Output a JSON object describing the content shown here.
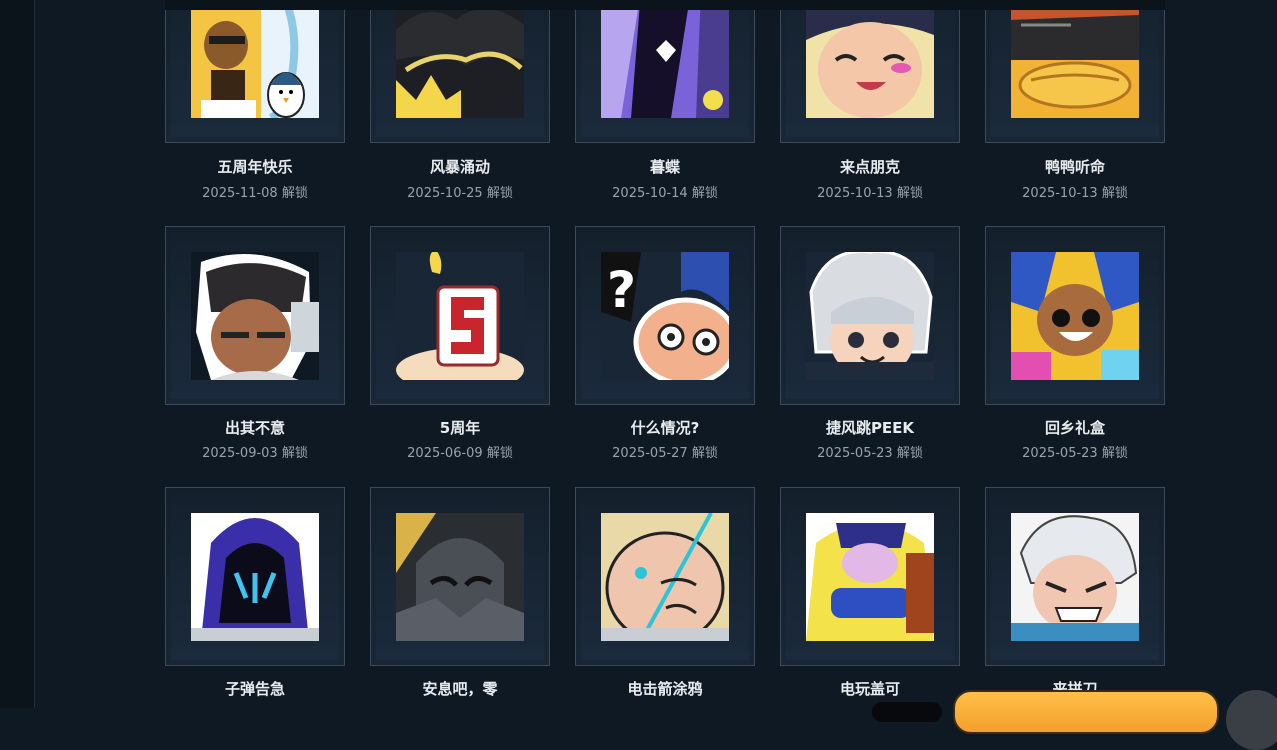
{
  "sprays": [
    {
      "name": "五周年快乐",
      "date": "2025-11-08 解锁",
      "icon": "bear-and-penguin-spray-icon"
    },
    {
      "name": "风暴涌动",
      "date": "2025-10-25 解锁",
      "icon": "storm-crown-spray-icon"
    },
    {
      "name": "暮蝶",
      "date": "2025-10-14 解锁",
      "icon": "purple-butterfly-spray-icon"
    },
    {
      "name": "来点朋克",
      "date": "2025-10-13 解锁",
      "icon": "punk-girl-spray-icon"
    },
    {
      "name": "鸭鸭听命",
      "date": "2025-10-13 解锁",
      "icon": "duck-sunglasses-spray-icon"
    },
    {
      "name": "出其不意",
      "date": "2025-09-03 解锁",
      "icon": "suspicious-agent-spray-icon"
    },
    {
      "name": "5周年",
      "date": "2025-06-09 解锁",
      "icon": "birthday-candle-5-spray-icon"
    },
    {
      "name": "什么情况?",
      "date": "2025-05-27 解锁",
      "icon": "confused-face-spray-icon"
    },
    {
      "name": "捷风跳PEEK",
      "date": "2025-05-23 解锁",
      "icon": "jett-peek-spray-icon"
    },
    {
      "name": "回乡礼盒",
      "date": "2025-05-23 解锁",
      "icon": "neon-gift-spray-icon"
    },
    {
      "name": "子弹告急",
      "date": "",
      "icon": "omen-hood-spray-icon"
    },
    {
      "name": "安息吧，零",
      "date": "",
      "icon": "mask-rest-spray-icon"
    },
    {
      "name": "电击箭涂鸦",
      "date": "",
      "icon": "shock-dart-spray-icon"
    },
    {
      "name": "电玩盖可",
      "date": "",
      "icon": "gamer-gekko-spray-icon"
    },
    {
      "name": "来拼刀",
      "date": "",
      "icon": "knife-fight-spray-icon"
    }
  ]
}
